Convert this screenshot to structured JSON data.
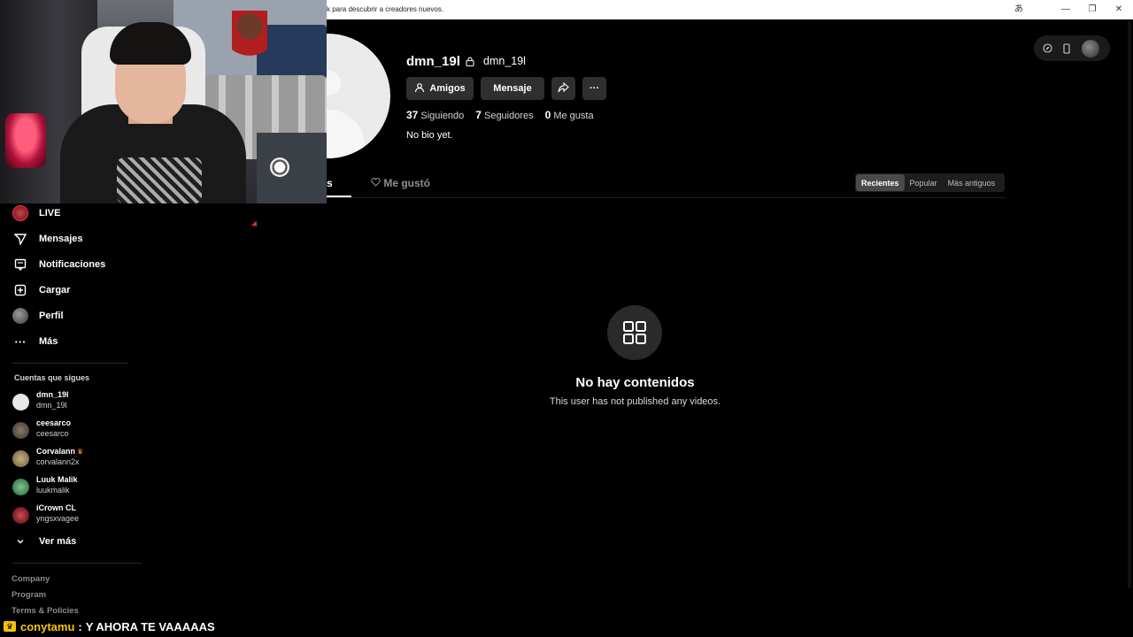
{
  "window": {
    "tip_text": "k para descubrir a creadores nuevos.",
    "controls": [
      "あ",
      "—",
      "❐",
      "✕"
    ]
  },
  "sidebar": {
    "items": [
      {
        "label": "LIVE",
        "icon": "live-avatar"
      },
      {
        "label": "Mensajes",
        "icon": "paper-plane-icon"
      },
      {
        "label": "Notificaciones",
        "icon": "message-box-icon"
      },
      {
        "label": "Cargar",
        "icon": "plus-square-icon"
      },
      {
        "label": "Perfil",
        "icon": "profile-avatar"
      },
      {
        "label": "Más",
        "icon": "more-dots-icon"
      }
    ],
    "following_title": "Cuentas que sigues",
    "following": [
      {
        "name": "dmn_19l",
        "username": "dmn_19l",
        "avatar_color": "#e8e8e8"
      },
      {
        "name": "ceesarco",
        "username": "ceesarco",
        "avatar_color": "#5a5048"
      },
      {
        "name": "Corvalann",
        "username": "corvalann2x",
        "avatar_color": "#8f7b5a",
        "crown": "♛"
      },
      {
        "name": "Luuk Malik",
        "username": "luukmalik",
        "avatar_color": "#3e8a4f"
      },
      {
        "name": "iCrown CL",
        "username": "yngsxvagee",
        "avatar_color": "#8a1f2a"
      }
    ],
    "see_more": "Ver más",
    "footer": [
      "Company",
      "Program",
      "Terms & Policies"
    ]
  },
  "profile": {
    "username": "dmn_19l",
    "nickname": "dmn_19l",
    "buttons": {
      "friends": "Amigos",
      "message": "Mensaje"
    },
    "stats": [
      {
        "value": "37",
        "label": "Siguiendo"
      },
      {
        "value": "7",
        "label": "Seguidores"
      },
      {
        "value": "0",
        "label": "Me gusta"
      }
    ],
    "bio": "No bio yet."
  },
  "tabs": {
    "videos_partial": "s",
    "liked": "Me gustó"
  },
  "sort": [
    "Recientes",
    "Popular",
    "Más antiguos"
  ],
  "empty": {
    "title": "No hay contenidos",
    "subtitle": "This user has not published any videos."
  },
  "chat": {
    "user": "conytamu",
    "separator": ":",
    "message": "Y AHORA TE VAAAAAS"
  },
  "colors": {
    "accent": "#fe2c55",
    "chat_user": "#f5c400"
  }
}
